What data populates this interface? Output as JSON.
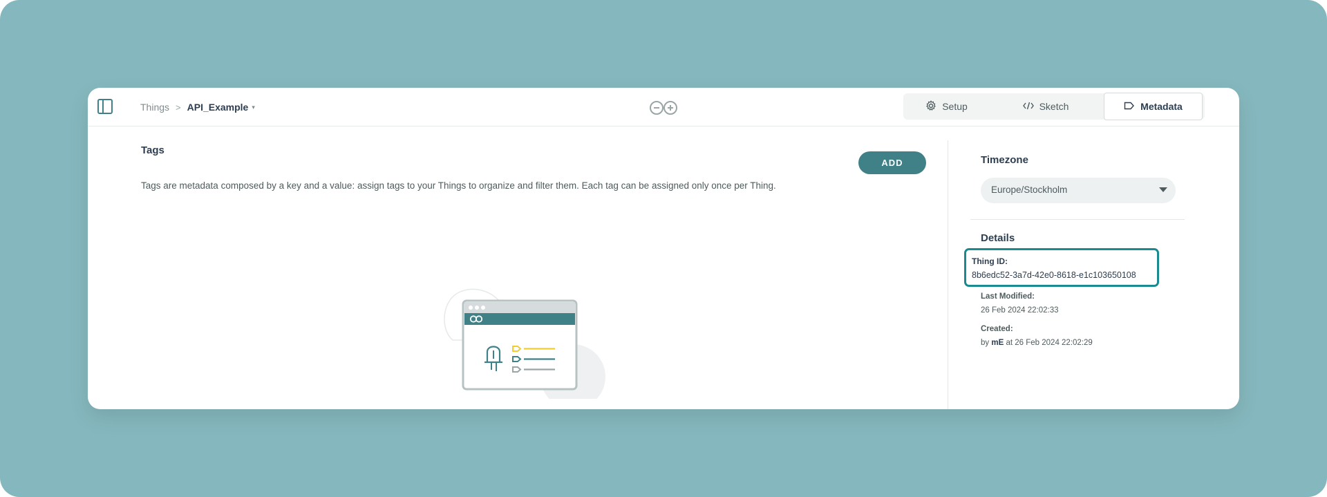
{
  "header": {
    "breadcrumb": {
      "parent": "Things",
      "separator": ">",
      "current": "API_Example",
      "caret": "▾"
    },
    "tabs": [
      {
        "label": "Setup",
        "icon": "gear-icon"
      },
      {
        "label": "Sketch",
        "icon": "code-icon"
      },
      {
        "label": "Metadata",
        "icon": "tag-icon",
        "active": true
      }
    ]
  },
  "tags": {
    "title": "Tags",
    "add_label": "ADD",
    "description": "Tags are metadata composed by a key and a value: assign tags to your Things to organize and filter them. Each tag can be assigned only once per Thing."
  },
  "timezone": {
    "label": "Timezone",
    "value": "Europe/Stockholm"
  },
  "details": {
    "label": "Details",
    "thing_id_label": "Thing ID:",
    "thing_id": "8b6edc52-3a7d-42e0-8618-e1c103650108",
    "last_modified_label": "Last Modified:",
    "last_modified": "26 Feb 2024 22:02:33",
    "created_label": "Created:",
    "created_by": "mE",
    "created_by_prefix": "by",
    "created_at_prefix": "at",
    "created_at": "26 Feb 2024 22:02:29"
  },
  "colors": {
    "background": "#85b8be",
    "accent": "#3f8187",
    "highlight": "#1a8a91",
    "illustration_yellow": "#f2cd2e"
  }
}
